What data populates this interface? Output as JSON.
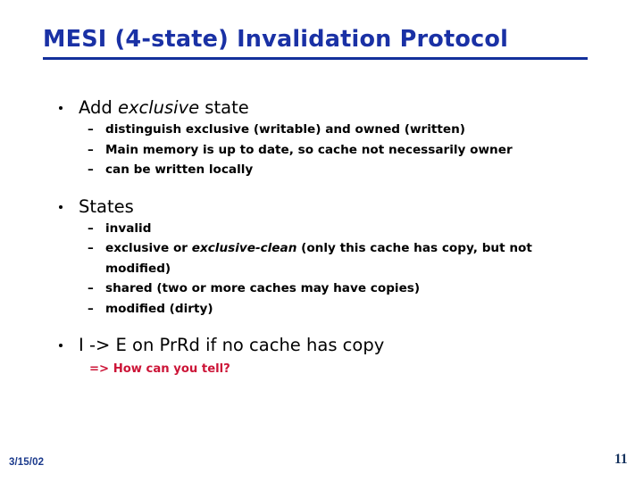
{
  "slide": {
    "title": "MESI (4-state) Invalidation Protocol",
    "title_color": "#1a31a5",
    "rule_color": "#13309b",
    "background_color": "#ffffff",
    "body": {
      "bullets": [
        {
          "text_parts": [
            {
              "text": "Add ",
              "style": "normal"
            },
            {
              "text": "exclusive",
              "style": "italic"
            },
            {
              "text": " state",
              "style": "normal"
            }
          ],
          "plain_text": "Add exclusive state",
          "sub_bullets": [
            {
              "plain_text": "distinguish exclusive (writable) and owned (written)",
              "text_parts": [
                {
                  "text": "distinguish exclusive (writable) and owned (written)",
                  "style": "normal"
                }
              ]
            },
            {
              "plain_text": "Main memory is up to date, so cache not necessarily owner",
              "text_parts": [
                {
                  "text": "Main memory is up to date, so cache not necessarily owner",
                  "style": "normal"
                }
              ]
            },
            {
              "plain_text": "can be written locally",
              "text_parts": [
                {
                  "text": "can be written locally",
                  "style": "normal"
                }
              ]
            }
          ]
        },
        {
          "text_parts": [
            {
              "text": "States",
              "style": "normal"
            }
          ],
          "plain_text": "States",
          "sub_bullets": [
            {
              "plain_text": "invalid",
              "text_parts": [
                {
                  "text": "invalid",
                  "style": "normal"
                }
              ]
            },
            {
              "plain_text": "exclusive or exclusive-clean (only this cache has copy, but not modified)",
              "text_parts": [
                {
                  "text": "exclusive or ",
                  "style": "normal"
                },
                {
                  "text": "exclusive-clean",
                  "style": "italic"
                },
                {
                  "text": " (only this cache has copy, but not modified)",
                  "style": "normal"
                }
              ]
            },
            {
              "plain_text": "shared (two or more caches may have copies)",
              "text_parts": [
                {
                  "text": "shared (two or more caches may have copies)",
                  "style": "normal"
                }
              ]
            },
            {
              "plain_text": "modified (dirty)",
              "text_parts": [
                {
                  "text": "modified (dirty)",
                  "style": "normal"
                }
              ]
            }
          ]
        },
        {
          "text_parts": [
            {
              "text": "I -> E on PrRd if no cache has copy",
              "style": "normal"
            }
          ],
          "plain_text": "I -> E on PrRd if no cache has copy",
          "sub_bullets": [],
          "note": {
            "text": "=> How can you tell?",
            "color": "#cc1437"
          }
        }
      ],
      "bullet_marker_level1": "•",
      "bullet_marker_level2": "–"
    }
  },
  "footer": {
    "date": "3/15/02",
    "date_color": "#1b3a8c",
    "page_number": "11",
    "page_number_color": "#16335e"
  }
}
